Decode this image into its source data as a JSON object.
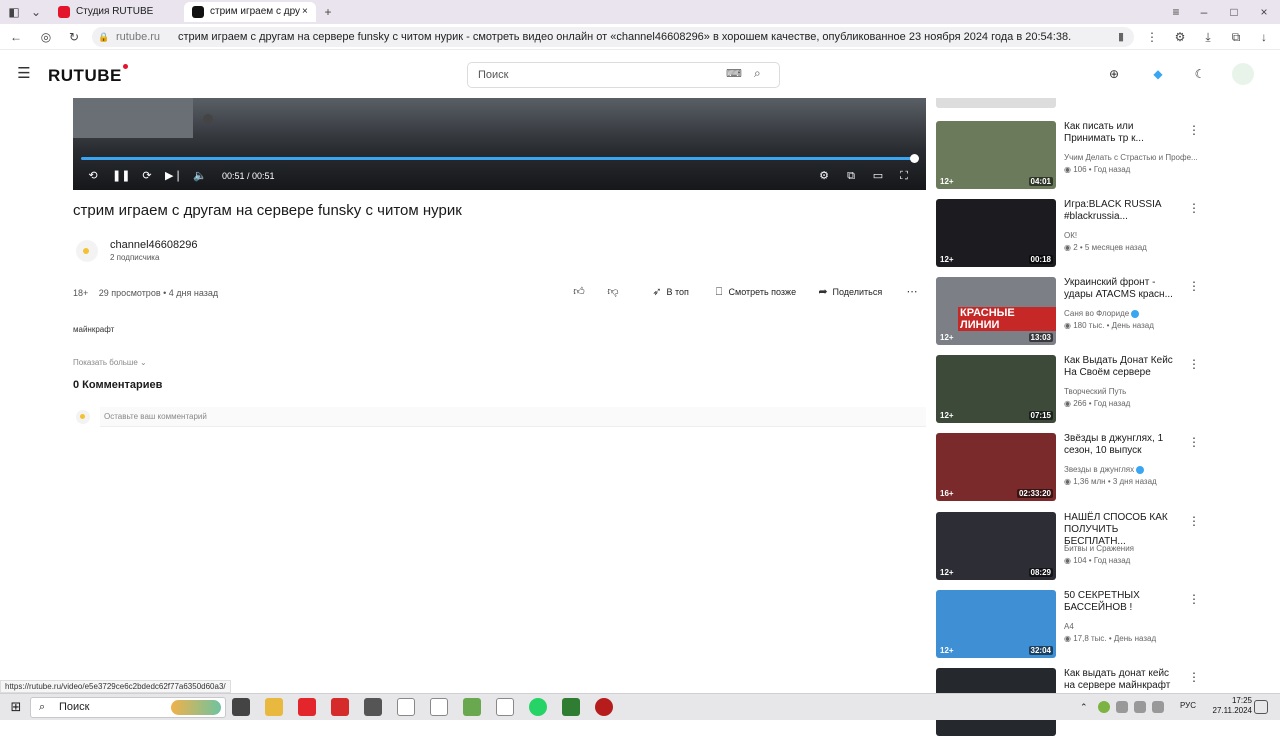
{
  "browser": {
    "tabs": [
      {
        "label": "Студия RUTUBE",
        "active": false
      },
      {
        "label": "стрим играем с дру",
        "active": true
      }
    ],
    "address_domain": "rutube.ru",
    "address_title": "стрим играем с другам на сервере funsky с читом нурик - смотреть видео онлайн от «channel46608296» в хорошем качестве, опубликованное 23 ноября 2024 года в 20:54:38.",
    "status_url": "https://rutube.ru/video/e5e3729ce6c2bdedc62f77a6350d60a3/"
  },
  "site": {
    "logo": "RUTUBE",
    "search_placeholder": "Поиск"
  },
  "player": {
    "time": "00:51 / 00:51",
    "progress": 1.0
  },
  "video": {
    "title": "стрим играем с другам на сервере funsky с читом нурик",
    "channel": "channel46608296",
    "subscribers": "2 подписчика",
    "age_rating": "18+",
    "views": "29 просмотров",
    "date": "4 дня назад",
    "actions": {
      "top": "В топ",
      "watch_later": "Смотреть позже",
      "share": "Поделиться"
    },
    "description": "майнкрафт",
    "show_more": "Показать больше",
    "comments_count": "0 Комментариев",
    "comment_placeholder": "Оставьте ваш комментарий"
  },
  "recommendations": [
    {
      "title": "Как писать или Принимать тр к...",
      "channel": "Учим Делать с Страстью и Профе...",
      "views": "106",
      "date": "Год назад",
      "age": "12+",
      "duration": "04:01",
      "verified": false,
      "thumb_color": "#6b7a5a"
    },
    {
      "title": "Игра:BLACK RUSSIA #blackrussia...",
      "channel": "ОК!",
      "views": "2",
      "date": "5 месяцев назад",
      "age": "12+",
      "duration": "00:18",
      "verified": false,
      "thumb_color": "#1c1c20"
    },
    {
      "title": "Украинский фронт - удары ATACMS красн...",
      "channel": "Саня во Флориде",
      "views": "180 тыс.",
      "date": "День назад",
      "age": "12+",
      "duration": "13:03",
      "verified": true,
      "thumb_color": "#7d7f86",
      "overlay_text": "КРАСНЫЕ ЛИНИИ"
    },
    {
      "title": "Как Выдать Донат Кейс На Своём сервере",
      "channel": "Творческий Путь",
      "views": "266",
      "date": "Год назад",
      "age": "12+",
      "duration": "07:15",
      "verified": false,
      "thumb_color": "#3d4a3a"
    },
    {
      "title": "Звёзды в джунглях, 1 сезон, 10 выпуск",
      "channel": "Звезды в джунглях",
      "views": "1,36 млн",
      "date": "3 дня назад",
      "age": "16+",
      "duration": "02:33:20",
      "verified": true,
      "thumb_color": "#7a2a2a"
    },
    {
      "title": "НАШЁЛ СПОСОБ КАК ПОЛУЧИТЬ БЕСПЛАТН...",
      "channel": "Битвы и Сражения",
      "views": "104",
      "date": "Год назад",
      "age": "12+",
      "duration": "08:29",
      "verified": false,
      "thumb_color": "#2d2d35"
    },
    {
      "title": "50 СЕКРЕТНЫХ БАССЕЙНОВ !",
      "channel": "А4",
      "views": "17,8 тыс.",
      "date": "День назад",
      "age": "12+",
      "duration": "32:04",
      "verified": false,
      "thumb_color": "#3f8fd4"
    },
    {
      "title": "Как выдать донат кейс на сервере майнкрафт",
      "channel": "",
      "views": "",
      "date": "",
      "age": "",
      "duration": "",
      "verified": false,
      "thumb_color": "#25282c"
    }
  ],
  "taskbar": {
    "search_label": "Поиск",
    "language": "РУС",
    "time": "17:25",
    "date": "27.11.2024"
  },
  "colors": {
    "accent_blue": "#3aa6f2",
    "logo_red": "#e4142b"
  }
}
